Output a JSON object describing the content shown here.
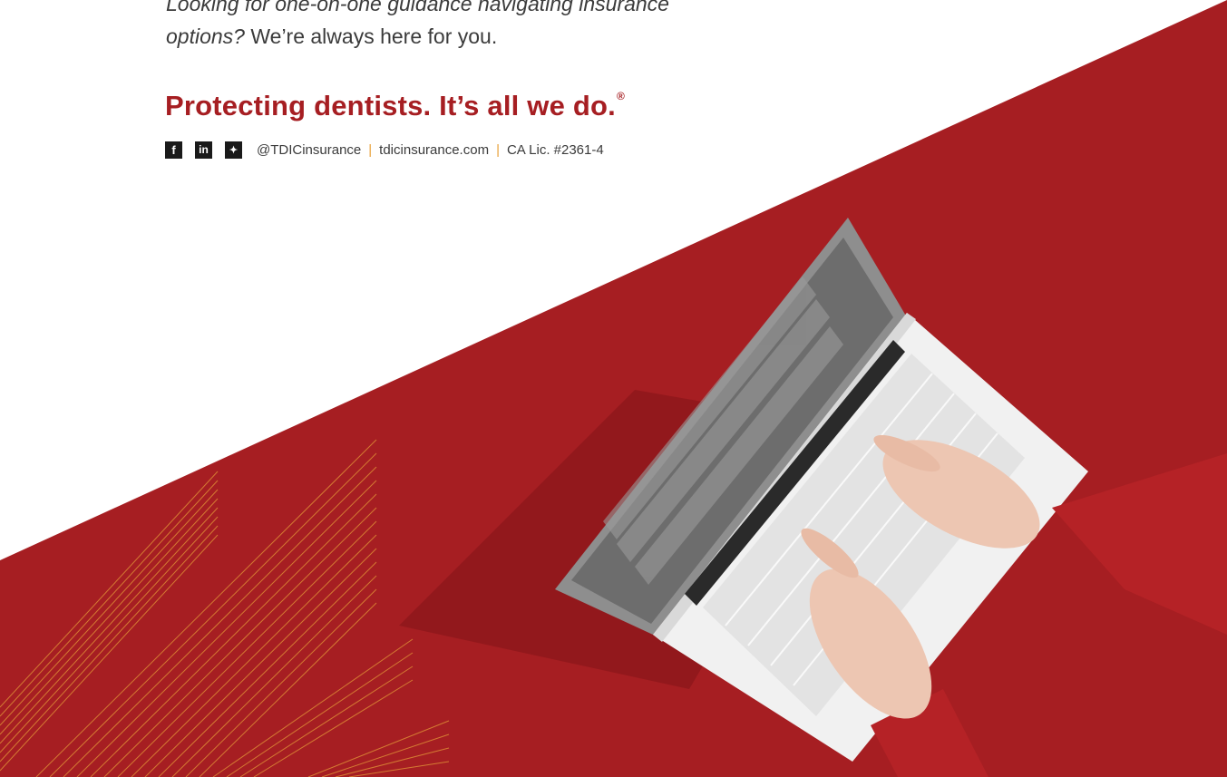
{
  "intro": {
    "line1_italic": "Looking for one-on-one guidance navigating insurance",
    "line2_italic": "options?",
    "line2_rest": " We’re always here for you."
  },
  "tagline": {
    "text": "Protecting dentists. It’s all we do.",
    "mark": "®"
  },
  "social": {
    "icons": [
      "facebook-icon",
      "linkedin-icon",
      "twitter-icon"
    ],
    "facebook_glyph": "f",
    "linkedin_glyph": "in",
    "twitter_glyph": "✦",
    "handle": "@TDICinsurance",
    "website": "tdicinsurance.com",
    "license": "CA Lic. #2361-4",
    "separator": "|"
  },
  "colors": {
    "brand_red": "#a61e22",
    "accent_orange": "#e8a13a",
    "text_gray": "#3b3b3b"
  }
}
